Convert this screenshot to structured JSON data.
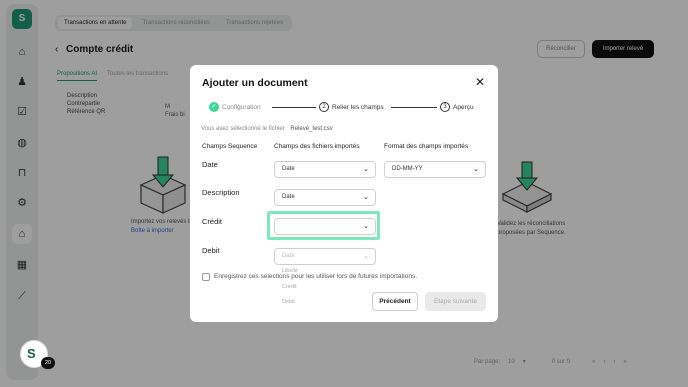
{
  "app": {
    "logo_letter": "S",
    "top_tabs": [
      "Transactions en attente",
      "Transactions réconciliées",
      "Transactions rejetées"
    ],
    "page_title": "Compte crédit",
    "reconcile_label": "Réconcilier",
    "import_label": "Importer relevé",
    "sub_tabs": [
      "Propositions AI",
      "Toutes les transactions"
    ],
    "filter_labels": [
      "Description",
      "Contrepartie",
      "Référence QR"
    ],
    "mid_col": [
      "M",
      "Frais bi"
    ],
    "empty_left_text": "Importez vos relevés",
    "empty_left_suffix": "la",
    "empty_left_link": "Boîte à importer",
    "empty_right_text": "Validez les réconciliations proposées par Sequence.",
    "pager": {
      "per_page_label": "Par page:",
      "per_page_value": "10",
      "range": "0 sur 0"
    },
    "rail_icons": [
      "home-icon",
      "user-icon",
      "check-square-icon",
      "bag-icon",
      "lock-icon",
      "gear-icon",
      "bank-icon",
      "chart-icon",
      "trend-icon"
    ]
  },
  "modal": {
    "title": "Ajouter un document",
    "steps": [
      {
        "label": "Configuration",
        "state": "done"
      },
      {
        "number": "2",
        "label": "Relier les champs",
        "state": "active"
      },
      {
        "number": "3",
        "label": "Aperçu",
        "state": "todo"
      }
    ],
    "file_prefix": "Vous avez sélectionné le fichier",
    "file_name": "Relevé_test.csv",
    "col_headers": [
      "Champs Sequence",
      "Champs des fichiers importés",
      "Format des champs importés"
    ],
    "rows": [
      {
        "label": "Date",
        "imported": "Date",
        "format": "DD-MM-YY"
      },
      {
        "label": "Description",
        "imported": "Date"
      },
      {
        "label": "Crédit",
        "imported": ""
      },
      {
        "label": "Debit",
        "imported": "Date"
      }
    ],
    "dropdown_options": [
      "Libellé",
      "Crédit",
      "Debit"
    ],
    "save_checkbox_label": "Enregistrez ces sélections pour les utiliser lors de futures importations.",
    "prev_label": "Précédent",
    "next_label": "Etape suivante"
  },
  "chat": {
    "badge": "20"
  },
  "colors": {
    "accent": "#1e9a77",
    "highlight": "#7fe8be",
    "check": "#3ed598"
  }
}
